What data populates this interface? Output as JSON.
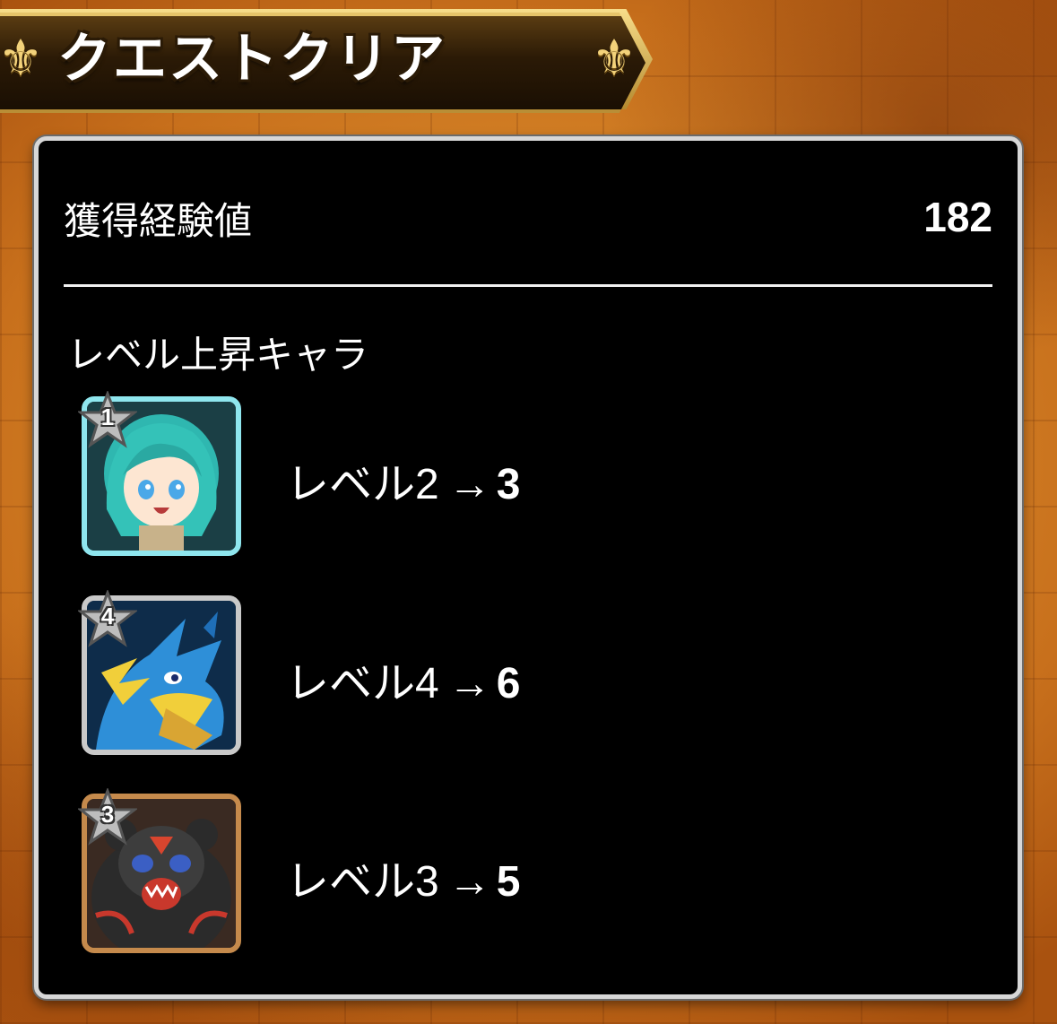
{
  "header": {
    "title": "クエストクリア"
  },
  "experience": {
    "label": "獲得経験値",
    "value": "182"
  },
  "level_up": {
    "label": "レベル上昇キャラ",
    "level_prefix": "レベル",
    "arrow": "→",
    "characters": [
      {
        "stars": "1",
        "from": "2",
        "to": "3",
        "frame": "cyan"
      },
      {
        "stars": "4",
        "from": "4",
        "to": "6",
        "frame": "silver"
      },
      {
        "stars": "3",
        "from": "3",
        "to": "5",
        "frame": "bronze"
      }
    ]
  },
  "colors": {
    "panel_background": "#000000",
    "panel_border": "#d7d7d7",
    "banner_gold": "#e6c46a",
    "frame_cyan": "#8fe6ee",
    "frame_silver": "#c9c9c9",
    "frame_bronze": "#c58a4c"
  }
}
